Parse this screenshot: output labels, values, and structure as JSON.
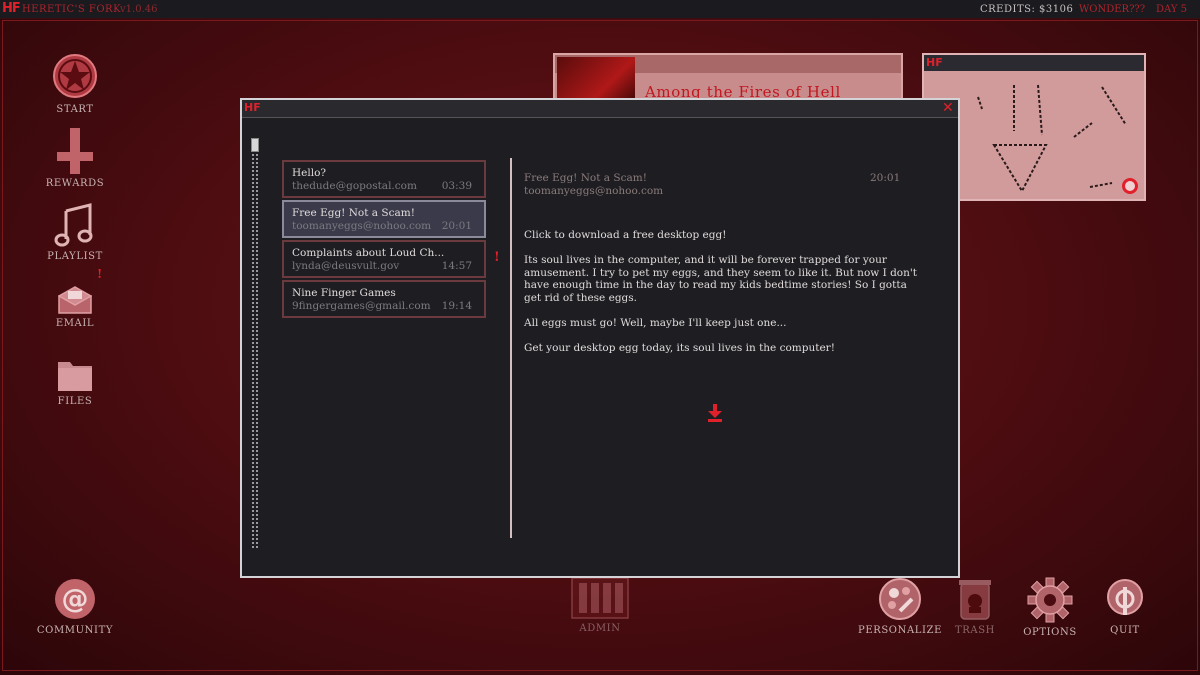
{
  "topbar": {
    "logo": "HF",
    "title": "HERETIC'S FORK",
    "version": "v1.0.46",
    "credits": "CREDITS: $3106",
    "wonder": "WONDER???",
    "day": "DAY 5"
  },
  "desktop_icons": {
    "start": "START",
    "rewards": "REWARDS",
    "playlist": "PLAYLIST",
    "email": "EMAIL",
    "files": "FILES",
    "community": "COMMUNITY",
    "admin": "ADMIN",
    "personalize": "PERSONALIZE",
    "trash": "TRASH",
    "options": "OPTIONS",
    "quit": "QUIT"
  },
  "background_window": {
    "title": "Among the Fires of Hell"
  },
  "egg_window": {
    "logo": "HF"
  },
  "email_window": {
    "logo": "HF",
    "close": "✕",
    "inbox": [
      {
        "subject": "Hello?",
        "sender": "thedude@gopostal.com",
        "time": "03:39",
        "selected": false
      },
      {
        "subject": "Free Egg! Not a Scam!",
        "sender": "toomanyeggs@nohoo.com",
        "time": "20:01",
        "selected": true
      },
      {
        "subject": "Complaints about Loud Ch...",
        "sender": "lynda@deusvult.gov",
        "time": "14:57",
        "selected": false
      },
      {
        "subject": "Nine Finger Games",
        "sender": "9fingergames@gmail.com",
        "time": "19:14",
        "selected": false
      }
    ],
    "alert_mark": "!",
    "reader": {
      "subject": "Free Egg! Not a Scam!",
      "sender": "toomanyeggs@nohoo.com",
      "time": "20:01",
      "paragraphs": [
        "Click to download a free desktop egg!",
        "Its soul lives in the computer, and it will be forever trapped for your amusement. I try to pet my eggs, and they seem to like it. But now I don't have enough time in the day to read my kids bedtime stories! So I gotta get rid of these eggs.",
        "All eggs must go! Well, maybe I'll keep just one...",
        "Get your desktop egg today, its soul lives in the computer!"
      ],
      "download_icon": "download-icon"
    }
  },
  "playlist_alert": "!",
  "colors": {
    "accent": "#e0202a",
    "background": "#4a0c10",
    "window_bg": "#1e1e22"
  }
}
